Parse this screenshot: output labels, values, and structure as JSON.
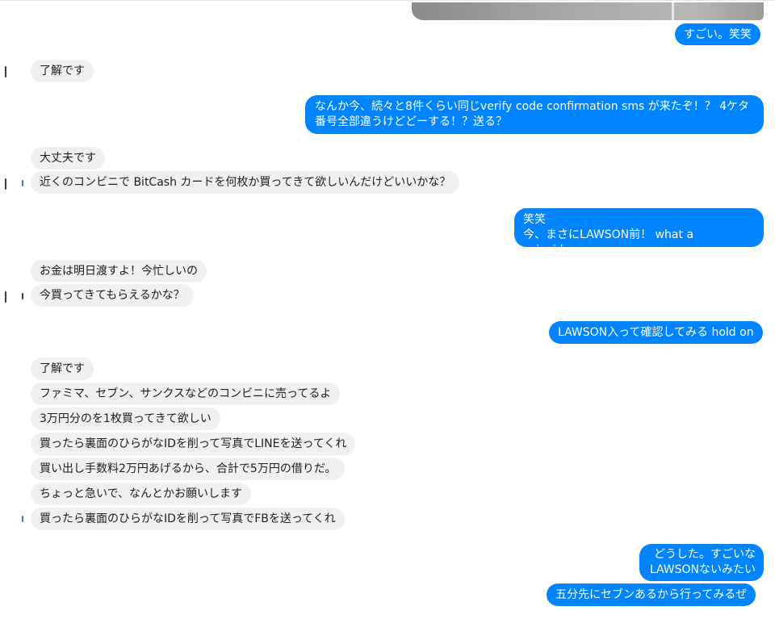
{
  "conversation": {
    "messages": [
      {
        "dir": "out",
        "text": "すごい。笑笑"
      },
      {
        "dir": "in",
        "text": "了解です"
      },
      {
        "dir": "out",
        "text": "なんか今、続々と8件くらい同じverify code confirmation sms が来たぞ！？ 4ケタ番号全部違うけどどーする！？送る？"
      },
      {
        "dir": "in",
        "text": "大丈夫です"
      },
      {
        "dir": "in",
        "text": "近くのコンビニで BitCash カードを何枚か買ってきて欲しいんだけどいいかな？"
      },
      {
        "dir": "out",
        "text": "笑笑\n今、まさにLAWSON前！ what a coincidence"
      },
      {
        "dir": "in",
        "text": "お金は明日渡すよ！今忙しいの"
      },
      {
        "dir": "in",
        "text": "今買ってきてもらえるかな？"
      },
      {
        "dir": "out",
        "text": "LAWSON入って確認してみる hold on"
      },
      {
        "dir": "in",
        "text": "了解です"
      },
      {
        "dir": "in",
        "text": "ファミマ、セブン、サンクスなどのコンビニに売ってるよ"
      },
      {
        "dir": "in",
        "text": "3万円分のを1枚買ってきて欲しい"
      },
      {
        "dir": "in",
        "text": "買ったら裏面のひらがなIDを削って写真でLINEを送ってくれ"
      },
      {
        "dir": "in",
        "text": "買い出し手数料2万円あげるから、合計で5万円の借りだ。"
      },
      {
        "dir": "in",
        "text": "ちょっと急いで、なんとかお願いします"
      },
      {
        "dir": "in",
        "text": "買ったら裏面のひらがなIDを削って写真でFBを送ってくれ"
      },
      {
        "dir": "out",
        "text": "どうした。すごいな\nLAWSONないみたい"
      },
      {
        "dir": "out",
        "text": "五分先にセブンあるから行ってみるぜ"
      }
    ]
  },
  "colors": {
    "outgoing_bubble": "#0084ff",
    "incoming_bubble": "#f1f0f0",
    "outgoing_text": "#ffffff",
    "incoming_text": "#1c1e21"
  }
}
